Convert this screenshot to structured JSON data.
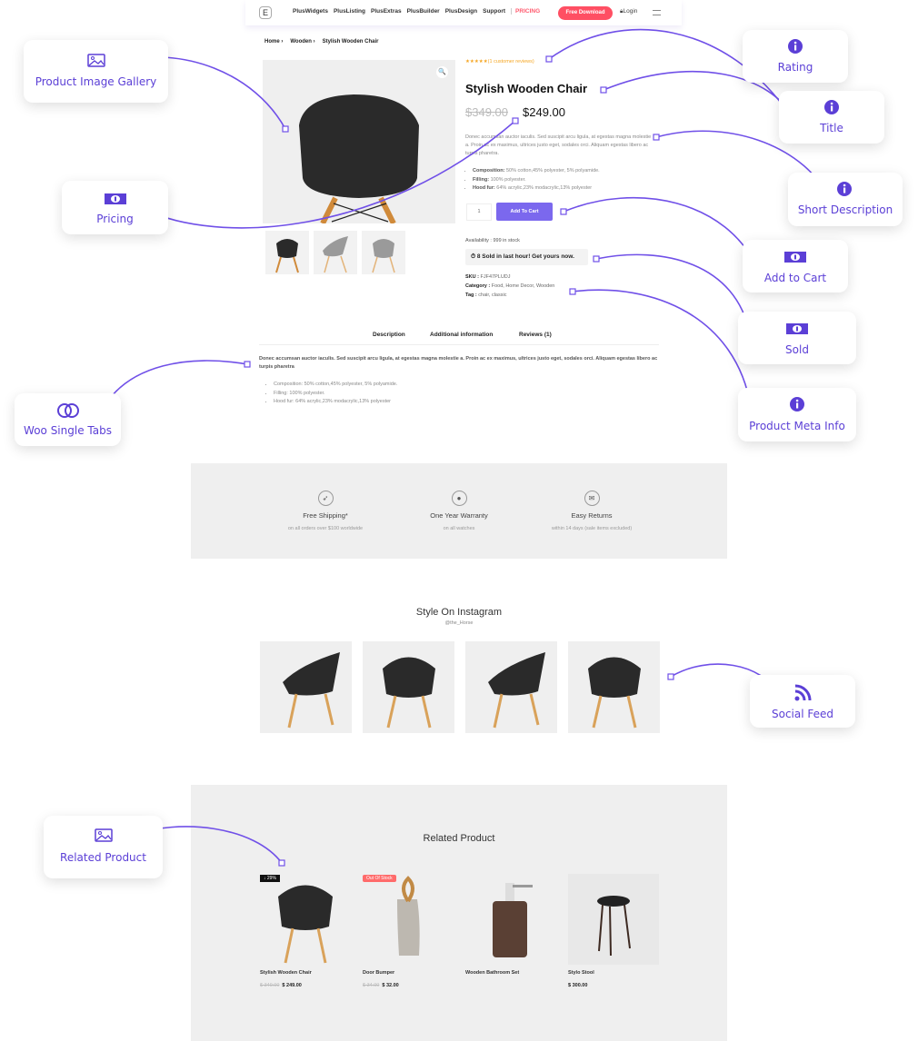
{
  "header": {
    "logo_glyph": "E",
    "nav": [
      "PlusWidgets",
      "PlusListing",
      "PlusExtras",
      "PlusBuilder",
      "PlusDesign",
      "Support"
    ],
    "pricing": "PRICING",
    "free_download": "Free Download",
    "login": "Login",
    "icons": {
      "login": "lock-icon",
      "menu": "hamburger-icon"
    }
  },
  "breadcrumb": [
    "Home",
    "Wooden",
    "Stylish Wooden Chair"
  ],
  "product": {
    "rating_stars": "★★★★★",
    "rating_text": "(1 customer reviews)",
    "title": "Stylish Wooden Chair",
    "old_price": "$349.00",
    "price": "$249.00",
    "short_description": "Donec accumsan auctor iaculis. Sed suscipit arcu ligula, at egestas magna molestie a. Proin ac ex maximus, ultrices justo eget, sodales orci. Aliquam egestas libero ac turpis pharetra.",
    "features": [
      {
        "label": "Composition:",
        "value": "50% cotton,45% polyester, 5% polyamide."
      },
      {
        "label": "Filling:",
        "value": "100% polyester."
      },
      {
        "label": "Hood fur:",
        "value": "64% acrylic,23% modacrylic,13% polyester"
      }
    ],
    "quantity": "1",
    "add_to_cart": "Add To Cart",
    "availability": "Availability : 999 in stock",
    "sold_text": "⏱ 8 Sold in last hour! Get yours now.",
    "sku_label": "SKU :",
    "sku": "FJF47PLUDJ",
    "category_label": "Category :",
    "category": "Food, Home Decor, Wooden",
    "tag_label": "Tag :",
    "tag": "chair, classic",
    "zoom_icon": "🔍"
  },
  "tabs": {
    "items": [
      "Description",
      "Additional information",
      "Reviews (1)"
    ],
    "description": "Donec accumsan auctor iaculis. Sed suscipit arcu ligula, at egestas magna molestie a. Proin ac ex maximus, ultrices justo eget, sodales orci. Aliquam egestas libero ac turpis pharetra",
    "list": [
      "Composition: 50% cotton,45% polyester, 5% polyamide.",
      "Filling: 100% polyester.",
      "Hood fur: 64% acrylic,23% modacrylic,13% polyester"
    ]
  },
  "features_bar": [
    {
      "icon": "➶",
      "title": "Free Shipping*",
      "subtitle": "on all orders over $100 worldwide"
    },
    {
      "icon": "●",
      "title": "One Year Warranty",
      "subtitle": "on all watches"
    },
    {
      "icon": "✉",
      "title": "Easy Returns",
      "subtitle": "within 14 days (sale items excluded)"
    }
  ],
  "instagram": {
    "title": "Style On Instagram",
    "handle": "@the_Horse"
  },
  "related": {
    "title": "Related Product",
    "items": [
      {
        "name": "Stylish Wooden Chair",
        "old_price": "$ 349.00",
        "price": "$ 249.00",
        "badge": "↓ 29%"
      },
      {
        "name": "Door Bumper",
        "old_price": "$ 34.00",
        "price": "$ 32.00",
        "badge": "Out Of Stock"
      },
      {
        "name": "Wooden Bathroom Set",
        "old_price": "",
        "price": "",
        "badge": ""
      },
      {
        "name": "Stylo Stool",
        "old_price": "",
        "price": "$ 300.00",
        "badge": ""
      }
    ]
  },
  "callouts": [
    {
      "label": "Product Image Gallery",
      "icon": "image-icon"
    },
    {
      "label": "Pricing",
      "icon": "banknote-icon"
    },
    {
      "label": "Woo Single Tabs",
      "icon": "toggle-circles-icon"
    },
    {
      "label": "Related Product",
      "icon": "image-icon"
    },
    {
      "label": "Rating",
      "icon": "info-icon"
    },
    {
      "label": "Title",
      "icon": "info-icon"
    },
    {
      "label": "Short Description",
      "icon": "info-icon"
    },
    {
      "label": "Add to Cart",
      "icon": "banknote-icon"
    },
    {
      "label": "Sold",
      "icon": "banknote-icon"
    },
    {
      "label": "Product Meta Info",
      "icon": "info-icon"
    },
    {
      "label": "Social Feed",
      "icon": "rss-icon"
    }
  ],
  "colors": {
    "accent": "#5b3fd6",
    "line": "#7050e8",
    "cta": "#ff4f63",
    "cart": "#7b68ee",
    "rating": "#f5a623"
  }
}
